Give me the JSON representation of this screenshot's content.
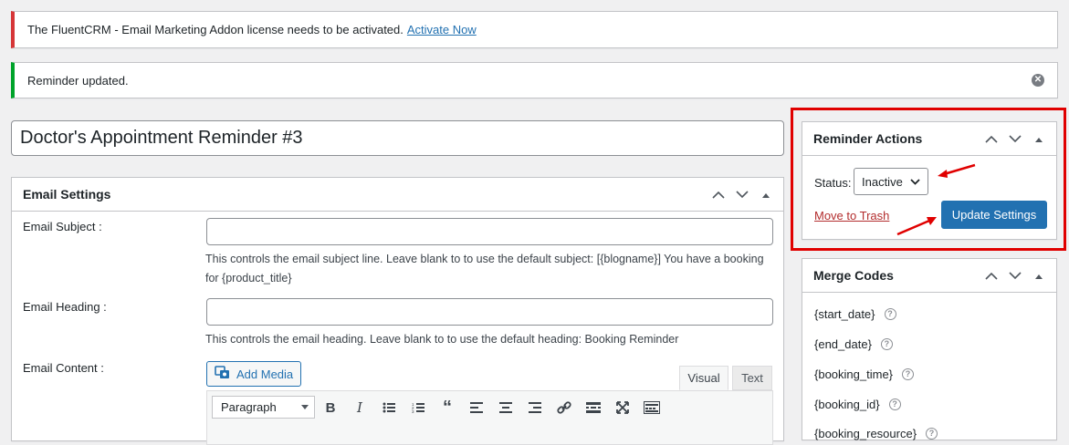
{
  "notices": {
    "license_text": "The FluentCRM - Email Marketing Addon license needs to be activated.",
    "activate_link": "Activate Now",
    "success_text": "Reminder updated.",
    "dismiss_icon": "close-circle-icon"
  },
  "title_value": "Doctor's Appointment Reminder #3",
  "email_settings": {
    "heading": "Email Settings",
    "subject_label": "Email Subject :",
    "subject_value": "",
    "subject_desc": "This controls the email subject line. Leave blank to to use the default subject: [{blogname}] You have a booking for {product_title}",
    "heading_label": "Email Heading :",
    "heading_value": "",
    "heading_desc": "This controls the email heading. Leave blank to to use the default heading: Booking Reminder",
    "content_label": "Email Content :",
    "add_media": "Add Media",
    "tab_visual": "Visual",
    "tab_text": "Text",
    "format_value": "Paragraph"
  },
  "reminder_actions": {
    "heading": "Reminder Actions",
    "status_label": "Status:",
    "status_value": "Inactive",
    "move_to_trash": "Move to Trash",
    "update_button": "Update Settings"
  },
  "merge_codes": {
    "heading": "Merge Codes",
    "items": [
      "{start_date}",
      "{end_date}",
      "{booking_time}",
      "{booking_id}",
      "{booking_resource}"
    ]
  },
  "colors": {
    "error_border": "#d63638",
    "success_border": "#00a32a",
    "primary": "#2271b1",
    "highlight": "#e00000"
  }
}
